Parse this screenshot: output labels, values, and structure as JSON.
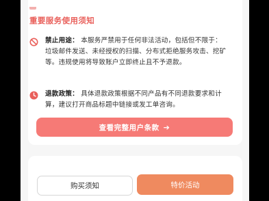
{
  "notice": {
    "title": "重要服务使用须知",
    "items": [
      {
        "icon": "ban-icon",
        "label": "禁止用途：",
        "text": "本服务严禁用于任何非法活动，包括但不限于：垃圾邮件发送、未经授权的扫描、分布式拒绝服务攻击、挖矿等。违规使用将导致账户立即终止且不予退款。"
      },
      {
        "icon": "clock-icon",
        "label": "退款政策：",
        "text": "具体退款政策根据不同产品有不同退款要求和计算，建议打开商品标题中链接或发工单咨询。"
      }
    ],
    "cta_label": "查看完整用户条款",
    "cta_arrow": "➔"
  },
  "actions": {
    "purchase_notice_label": "购买须知",
    "special_offer_label": "特价活动"
  },
  "colors": {
    "accent_red": "#e9605b",
    "cta_bg": "#f67a76",
    "orange_button": "#ef8a5f"
  }
}
